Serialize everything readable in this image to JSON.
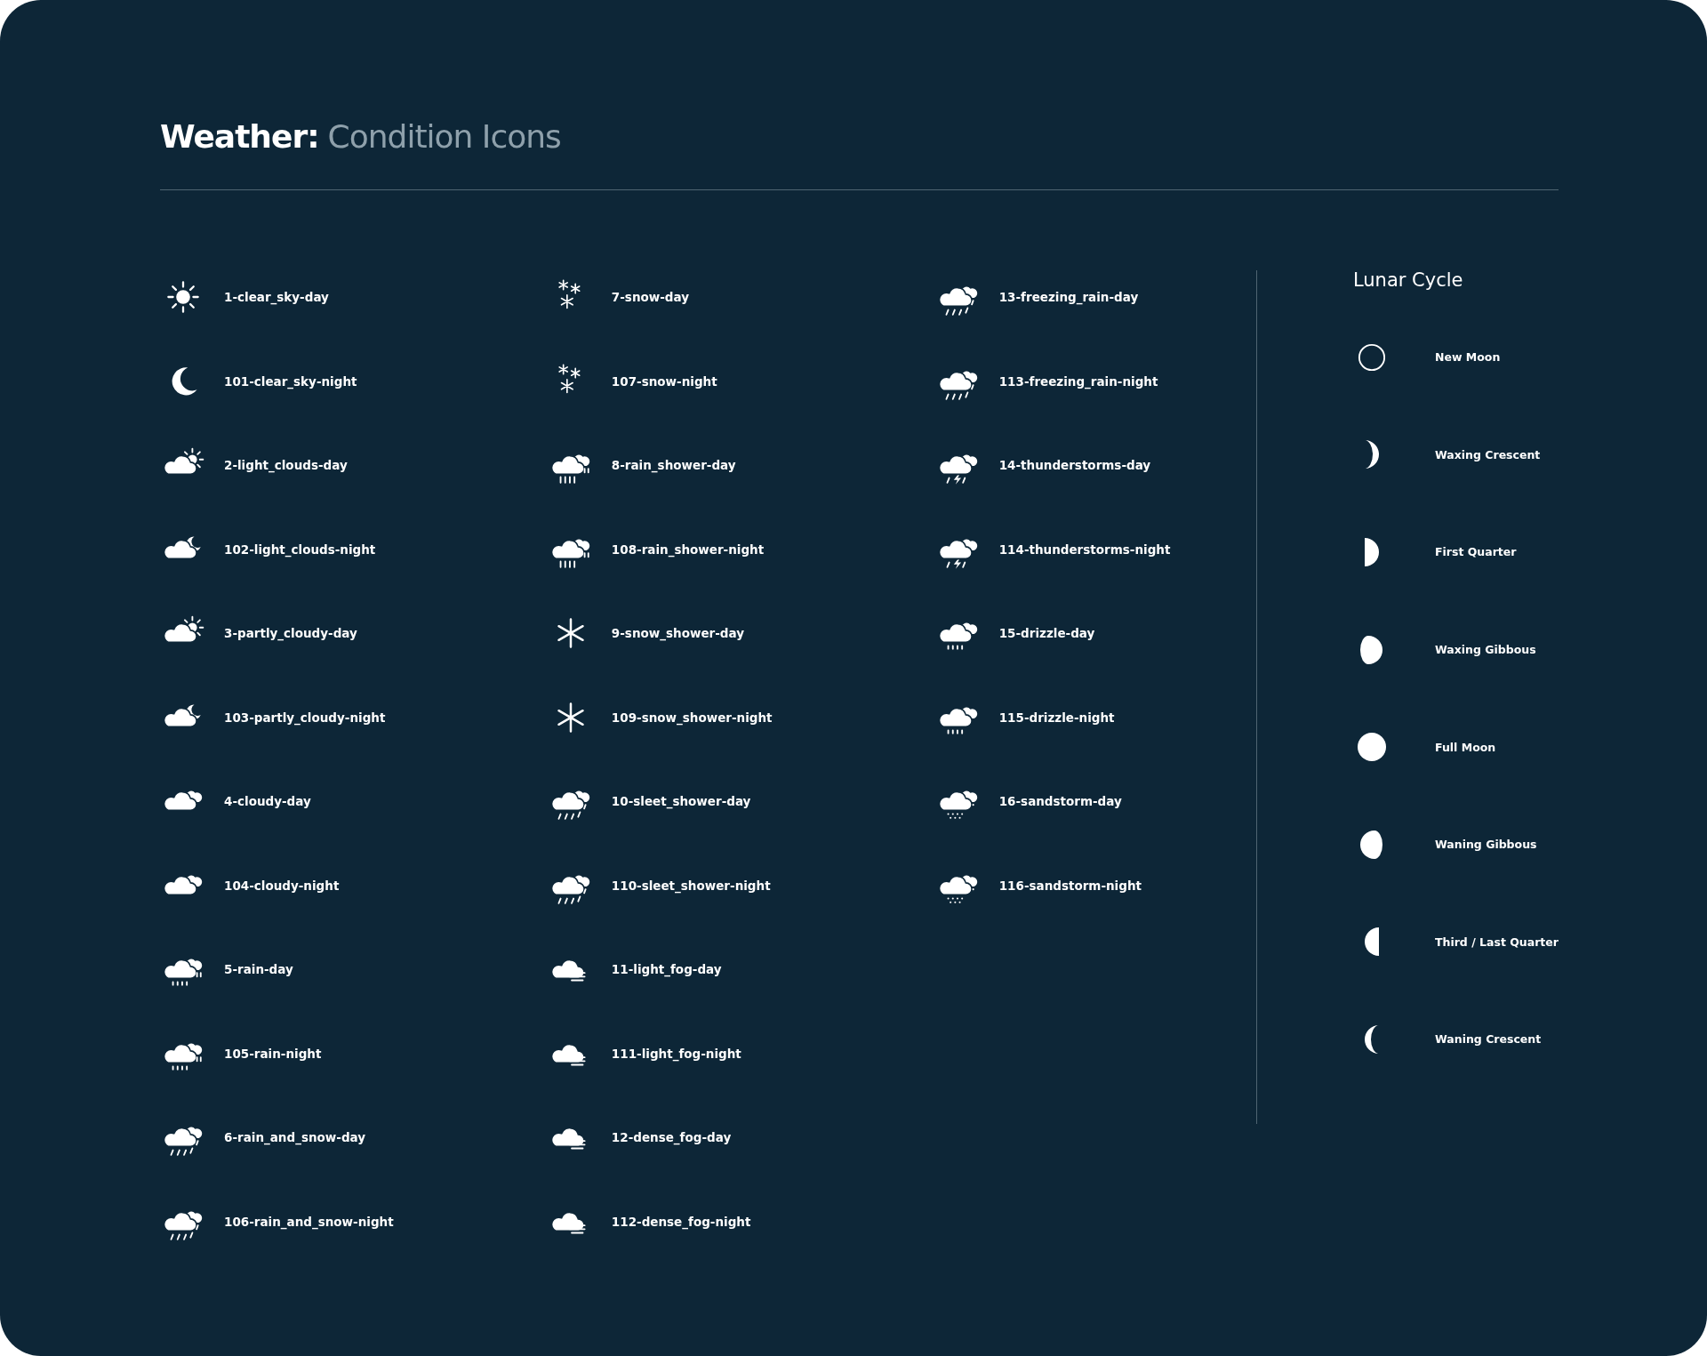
{
  "header": {
    "title": "Weather:",
    "subtitle": "Condition Icons"
  },
  "columns": [
    {
      "items": [
        {
          "label": "1-clear_sky-day",
          "kind": "sun"
        },
        {
          "label": "101-clear_sky-night",
          "kind": "moon"
        },
        {
          "label": "2-light_clouds-day",
          "kind": "cloud-sun"
        },
        {
          "label": "102-light_clouds-night",
          "kind": "cloud-moon"
        },
        {
          "label": "3-partly_cloudy-day",
          "kind": "cloud-sun"
        },
        {
          "label": "103-partly_cloudy-night",
          "kind": "cloud-moon"
        },
        {
          "label": "4-cloudy-day",
          "kind": "cloudy"
        },
        {
          "label": "104-cloudy-night",
          "kind": "cloudy"
        },
        {
          "label": "5-rain-day",
          "kind": "rain"
        },
        {
          "label": "105-rain-night",
          "kind": "rain"
        },
        {
          "label": "6-rain_and_snow-day",
          "kind": "slant"
        },
        {
          "label": "106-rain_and_snow-night",
          "kind": "slant"
        }
      ]
    },
    {
      "items": [
        {
          "label": "7-snow-day",
          "kind": "flakes"
        },
        {
          "label": "107-snow-night",
          "kind": "flakes"
        },
        {
          "label": "8-rain_shower-day",
          "kind": "shower"
        },
        {
          "label": "108-rain_shower-night",
          "kind": "shower"
        },
        {
          "label": "9-snow_shower-day",
          "kind": "snowflake"
        },
        {
          "label": "109-snow_shower-night",
          "kind": "snowflake"
        },
        {
          "label": "10-sleet_shower-day",
          "kind": "slant"
        },
        {
          "label": "110-sleet_shower-night",
          "kind": "slant"
        },
        {
          "label": "11-light_fog-day",
          "kind": "fog"
        },
        {
          "label": "111-light_fog-night",
          "kind": "fog"
        },
        {
          "label": "12-dense_fog-day",
          "kind": "fog"
        },
        {
          "label": "112-dense_fog-night",
          "kind": "fog"
        }
      ]
    },
    {
      "items": [
        {
          "label": "13-freezing_rain-day",
          "kind": "slant"
        },
        {
          "label": "113-freezing_rain-night",
          "kind": "slant"
        },
        {
          "label": "14-thunderstorms-day",
          "kind": "thunder"
        },
        {
          "label": "114-thunderstorms-night",
          "kind": "thunder"
        },
        {
          "label": "15-drizzle-day",
          "kind": "drizzle"
        },
        {
          "label": "115-drizzle-night",
          "kind": "drizzle"
        },
        {
          "label": "16-sandstorm-day",
          "kind": "sand"
        },
        {
          "label": "116-sandstorm-night",
          "kind": "sand"
        }
      ]
    }
  ],
  "lunar": {
    "title": "Lunar Cycle",
    "phases": [
      {
        "label": "New Moon",
        "kind": "new"
      },
      {
        "label": "Waxing Crescent",
        "kind": "waxing-crescent"
      },
      {
        "label": "First Quarter",
        "kind": "first-quarter"
      },
      {
        "label": "Waxing Gibbous",
        "kind": "waxing-gibbous"
      },
      {
        "label": "Full Moon",
        "kind": "full"
      },
      {
        "label": "Waning Gibbous",
        "kind": "waning-gibbous"
      },
      {
        "label": "Third / Last Quarter",
        "kind": "third-quarter"
      },
      {
        "label": "Waning Crescent",
        "kind": "waning-crescent"
      }
    ]
  }
}
